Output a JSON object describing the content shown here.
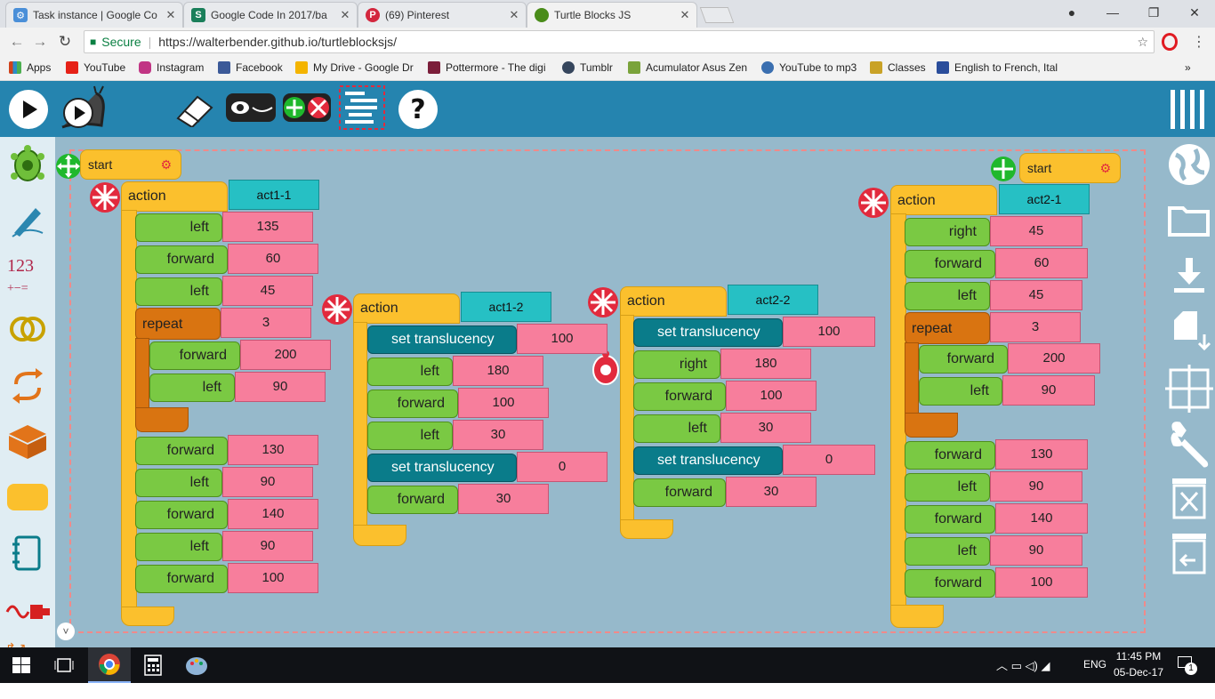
{
  "browser": {
    "tabs": [
      {
        "title": "Task instance | Google Co",
        "icon": "gear-favicon",
        "color": "#4a8fd8"
      },
      {
        "title": "Google Code In 2017/ba",
        "icon": "s-favicon",
        "color": "#1a7f5a"
      },
      {
        "title": "(69) Pinterest",
        "icon": "pinterest-favicon",
        "color": "#d3273e"
      },
      {
        "title": "Turtle Blocks JS",
        "icon": "turtle-favicon",
        "color": "#4a8c1a"
      }
    ],
    "secure_label": "Secure",
    "url": "https://walterbender.github.io/turtleblocksjs/",
    "bookmarks": [
      {
        "label": "Apps",
        "color": "#d0421b"
      },
      {
        "label": "YouTube",
        "color": "#e62117"
      },
      {
        "label": "Instagram",
        "color": "#c13584"
      },
      {
        "label": "Facebook",
        "color": "#3b5998"
      },
      {
        "label": "My Drive - Google Dr",
        "color": "#f4b400"
      },
      {
        "label": "Pottermore - The digi",
        "color": "#7b1e3a"
      },
      {
        "label": "Tumblr",
        "color": "#36465d"
      },
      {
        "label": "Acumulator Asus Zen",
        "color": "#7aa33b"
      },
      {
        "label": "YouTube to mp3",
        "color": "#3a6fb0"
      },
      {
        "label": "Classes",
        "color": "#c9a227"
      },
      {
        "label": "English to French, Ital",
        "color": "#2a4d9b"
      }
    ],
    "more_bookmarks": "»"
  },
  "app": {
    "start_label": "start",
    "action_label": "action",
    "repeat_label": "repeat",
    "stacks": [
      {
        "name": "act1-1",
        "commands": [
          {
            "label": "left",
            "value": "135"
          },
          {
            "label": "forward",
            "value": "60"
          },
          {
            "label": "left",
            "value": "45"
          }
        ],
        "repeat": {
          "value": "3",
          "commands": [
            {
              "label": "forward",
              "value": "200"
            },
            {
              "label": "left",
              "value": "90"
            }
          ]
        },
        "after": [
          {
            "label": "forward",
            "value": "130"
          },
          {
            "label": "left",
            "value": "90"
          },
          {
            "label": "forward",
            "value": "140"
          },
          {
            "label": "left",
            "value": "90"
          },
          {
            "label": "forward",
            "value": "100"
          }
        ]
      },
      {
        "name": "act1-2",
        "commands": [
          {
            "label": "set translucency",
            "value": "100"
          },
          {
            "label": "left",
            "value": "180"
          },
          {
            "label": "forward",
            "value": "100"
          },
          {
            "label": "left",
            "value": "30"
          },
          {
            "label": "set translucency",
            "value": "0"
          },
          {
            "label": "forward",
            "value": "30"
          }
        ]
      },
      {
        "name": "act2-2",
        "commands": [
          {
            "label": "set translucency",
            "value": "100"
          },
          {
            "label": "right",
            "value": "180"
          },
          {
            "label": "forward",
            "value": "100"
          },
          {
            "label": "left",
            "value": "30"
          },
          {
            "label": "set translucency",
            "value": "0"
          },
          {
            "label": "forward",
            "value": "30"
          }
        ]
      },
      {
        "name": "act2-1",
        "commands": [
          {
            "label": "right",
            "value": "45"
          },
          {
            "label": "forward",
            "value": "60"
          },
          {
            "label": "left",
            "value": "45"
          }
        ],
        "repeat": {
          "value": "3",
          "commands": [
            {
              "label": "forward",
              "value": "200"
            },
            {
              "label": "left",
              "value": "90"
            }
          ]
        },
        "after": [
          {
            "label": "forward",
            "value": "130"
          },
          {
            "label": "left",
            "value": "90"
          },
          {
            "label": "forward",
            "value": "140"
          },
          {
            "label": "left",
            "value": "90"
          },
          {
            "label": "forward",
            "value": "100"
          }
        ]
      }
    ],
    "palette_number_glyph": "123"
  },
  "taskbar": {
    "language": "ENG",
    "time": "11:45 PM",
    "date": "05-Dec-17",
    "notification_count": "1"
  },
  "colors": {
    "toolbar": "#2584af",
    "canvas": "#96b9cb",
    "action_block": "#fbc02d",
    "command_block": "#7ac943",
    "translucency_block": "#0a7c8a",
    "number_arg": "#f77e9c",
    "name_arg": "#26c0c4",
    "repeat_block": "#d97411"
  }
}
